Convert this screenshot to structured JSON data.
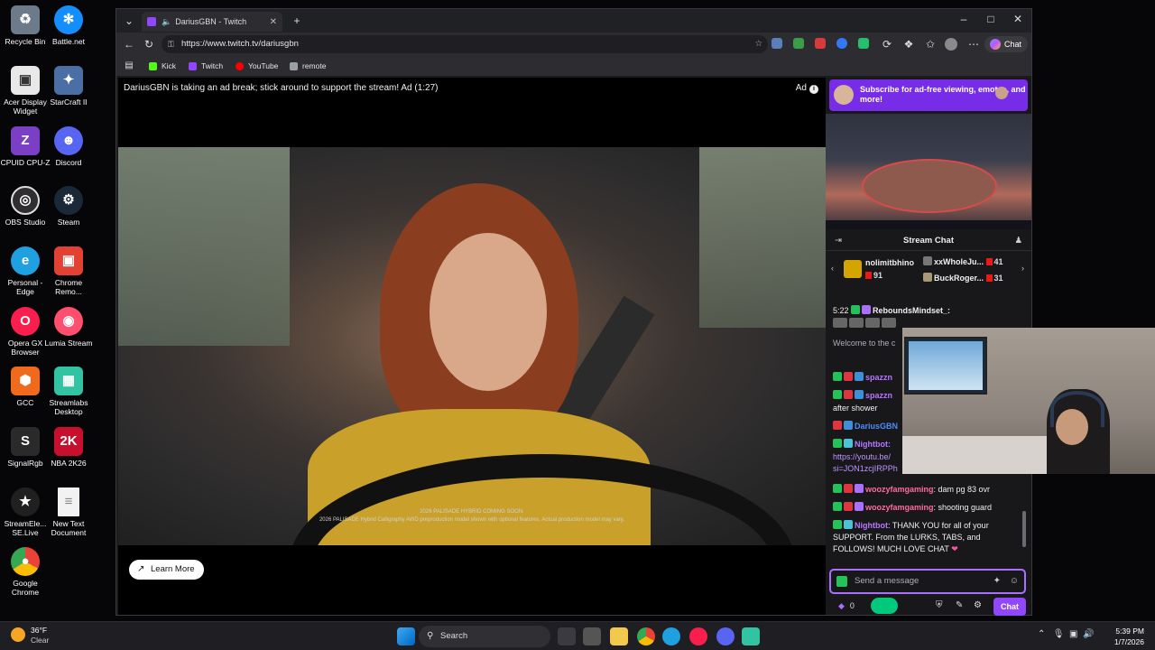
{
  "desktop": {
    "icons": [
      {
        "label": "Recycle Bin",
        "icon": "recycle-bin-icon",
        "color": "#6c7a8a"
      },
      {
        "label": "Battle.net",
        "icon": "battlenet-icon",
        "color": "#148eff"
      },
      {
        "label": "Acer Display Widget",
        "icon": "acer-icon",
        "color": "#e8e8e8"
      },
      {
        "label": "StarCraft II",
        "icon": "starcraft-icon",
        "color": "#4a6fa5"
      },
      {
        "label": "CPUID CPU-Z",
        "icon": "cpuz-icon",
        "color": "#7a3fc4"
      },
      {
        "label": "Discord",
        "icon": "discord-icon",
        "color": "#5865f2"
      },
      {
        "label": "OBS Studio",
        "icon": "obs-icon",
        "color": "#302e31"
      },
      {
        "label": "Steam",
        "icon": "steam-icon",
        "color": "#1b2838"
      },
      {
        "label": "Personal - Edge",
        "icon": "edge-icon",
        "color": "#1fa0e0"
      },
      {
        "label": "Chrome Remo...",
        "icon": "chrome-remote-icon",
        "color": "#e34133"
      },
      {
        "label": "Opera GX Browser",
        "icon": "operagx-icon",
        "color": "#fa1e4e"
      },
      {
        "label": "Lumia Stream",
        "icon": "lumia-icon",
        "color": "#ff4f6e"
      },
      {
        "label": "GCC",
        "icon": "gcc-icon",
        "color": "#f06a1d"
      },
      {
        "label": "Streamlabs Desktop",
        "icon": "streamlabs-icon",
        "color": "#31c3a2"
      },
      {
        "label": "SignalRgb",
        "icon": "signalrgb-icon",
        "color": "#2a2a2a"
      },
      {
        "label": "NBA 2K26",
        "icon": "nba2k-icon",
        "color": "#c8102e"
      },
      {
        "label": "StreamEle... SE.Live",
        "icon": "streamelements-icon",
        "color": "#202020"
      },
      {
        "label": "New Text Document",
        "icon": "text-document-icon",
        "color": "#f2f2f2"
      },
      {
        "label": "Google Chrome",
        "icon": "chrome-icon",
        "color": "#34a853"
      }
    ]
  },
  "browser": {
    "tab_title": "DariusGBN - Twitch",
    "url": "https://www.twitch.tv/dariusgbn",
    "chat_button": "Chat",
    "favorites": [
      "Kick",
      "Twitch",
      "YouTube",
      "remote"
    ]
  },
  "player": {
    "ad_banner": "DariusGBN is taking an ad break; stick around to support the stream! Ad (1:27)",
    "ad_label": "Ad",
    "disclaimer_line1": "2026 PALISADE HYBRID COMING SOON.",
    "disclaimer_line2": "2026 PALISADE Hybrid Calligraphy AWD preproduction model shown with optional features. Actual production model may vary.",
    "learn_more": "Learn More"
  },
  "sidebar": {
    "subscribe_banner": "Subscribe for ad-free viewing, emotes, and more!",
    "chat_title": "Stream Chat",
    "leaderboard": [
      {
        "name": "nolimitbhino",
        "count": "91"
      },
      {
        "name": "xxWholeJu...",
        "count": "41"
      },
      {
        "name": "BuckRoger...",
        "count": "31"
      }
    ],
    "messages": [
      {
        "time": "5:22",
        "user": "ReboundsMindset_:",
        "text": ""
      },
      {
        "user": "",
        "text": "Welcome to the c"
      },
      {
        "user": "spazzn",
        "text": ""
      },
      {
        "user": "spazzn",
        "text": ""
      },
      {
        "user": "",
        "text": "after shower"
      },
      {
        "user": "DariusGBN",
        "text": ""
      },
      {
        "user": "Nightbot:",
        "text": ""
      },
      {
        "user": "",
        "text": "https://youtu.be/"
      },
      {
        "user": "",
        "text": "si=JON1zcjIRPPh"
      },
      {
        "user": "woozyfamgaming",
        "text": ": dam pg 83 ovr"
      },
      {
        "user": "woozyfamgaming",
        "text": ": shooting guard"
      },
      {
        "user": "Nightbot",
        "text": ": THANK YOU for all of your SUPPORT. From the LURKS, TABS, and FOLLOWS! MUCH LOVE CHAT"
      }
    ],
    "input_placeholder": "Send a message",
    "points": "0",
    "send_label": "Chat"
  },
  "taskbar": {
    "temperature": "36°F",
    "weather": "Clear",
    "search_placeholder": "Search",
    "time": "5:39 PM",
    "date": "1/7/2026"
  }
}
